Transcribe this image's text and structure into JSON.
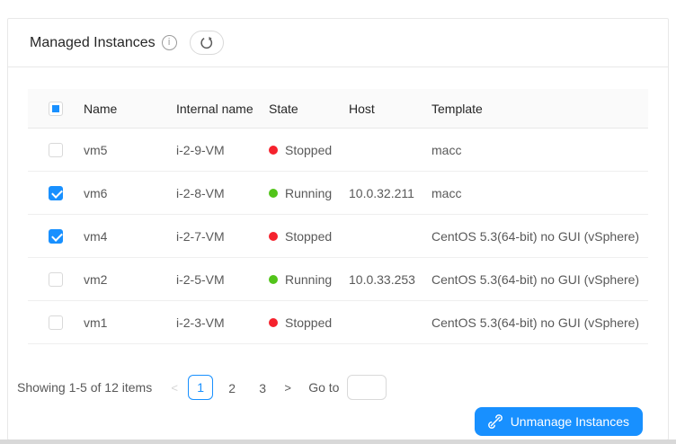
{
  "card": {
    "title": "Managed Instances"
  },
  "icons": {
    "info": "i",
    "prev": "<",
    "next": ">"
  },
  "table": {
    "columns": [
      "Name",
      "Internal name",
      "State",
      "Host",
      "Template"
    ],
    "header_checkbox_state": "indeterminate",
    "rows": [
      {
        "checked": false,
        "name": "vm5",
        "internal_name": "i-2-9-VM",
        "state": "Stopped",
        "state_color": "#f5222d",
        "host": "",
        "template": "macc"
      },
      {
        "checked": true,
        "name": "vm6",
        "internal_name": "i-2-8-VM",
        "state": "Running",
        "state_color": "#52c41a",
        "host": "10.0.32.211",
        "template": "macc"
      },
      {
        "checked": true,
        "name": "vm4",
        "internal_name": "i-2-7-VM",
        "state": "Stopped",
        "state_color": "#f5222d",
        "host": "",
        "template": "CentOS 5.3(64-bit) no GUI (vSphere)"
      },
      {
        "checked": false,
        "name": "vm2",
        "internal_name": "i-2-5-VM",
        "state": "Running",
        "state_color": "#52c41a",
        "host": "10.0.33.253",
        "template": "CentOS 5.3(64-bit) no GUI (vSphere)"
      },
      {
        "checked": false,
        "name": "vm1",
        "internal_name": "i-2-3-VM",
        "state": "Stopped",
        "state_color": "#f5222d",
        "host": "",
        "template": "CentOS 5.3(64-bit) no GUI (vSphere)"
      }
    ]
  },
  "pagination": {
    "summary": "Showing 1-5 of 12 items",
    "pages": [
      "1",
      "2",
      "3"
    ],
    "active_page": "1",
    "goto_label": "Go to",
    "goto_value": ""
  },
  "footer": {
    "unmanage_button_label": "Unmanage Instances"
  },
  "colors": {
    "primary": "#1890ff",
    "running": "#52c41a",
    "stopped": "#f5222d"
  }
}
